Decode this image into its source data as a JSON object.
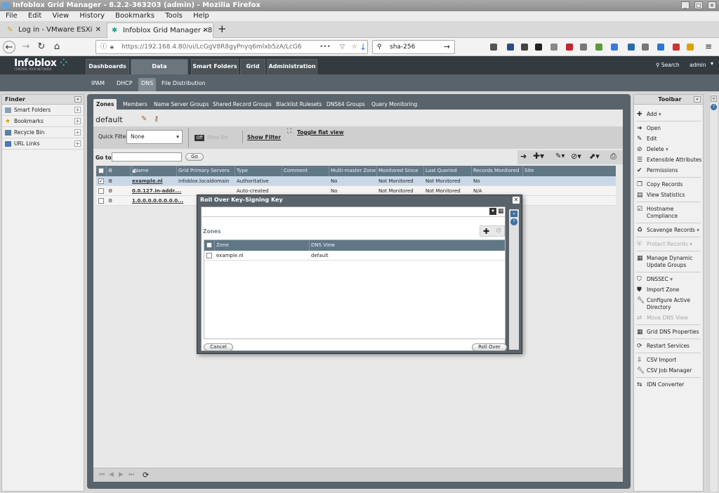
{
  "window": {
    "title": "Infoblox Grid Manager - 8.2.2-363203 (admin) - Mozilla Firefox"
  },
  "menu": [
    "File",
    "Edit",
    "View",
    "History",
    "Bookmarks",
    "Tools",
    "Help"
  ],
  "tabs": [
    {
      "label": "Log in - VMware ESXi"
    },
    {
      "label": "Infoblox Grid Manager - 8"
    }
  ],
  "nav": {
    "url": "https://192.168.4.80/ui/LcGgV8R8gyPnyq6mlxb5zA/LcG6",
    "search": "sha-256"
  },
  "app": {
    "logo": "Infoblox",
    "tagline": "CONTROL YOUR NETWORK",
    "top_tabs": [
      "Dashboards",
      "Data Management",
      "Smart Folders",
      "Grid",
      "Administration"
    ],
    "sub_tabs": [
      "IPAM",
      "DHCP",
      "DNS",
      "File Distribution"
    ],
    "search": "Search",
    "user": "admin"
  },
  "finder": {
    "title": "Finder",
    "items": [
      "Smart Folders",
      "Bookmarks",
      "Recycle Bin",
      "URL Links"
    ]
  },
  "zones_view": {
    "tabs": [
      "Zones",
      "Members",
      "Name Server Groups",
      "Shared Record Groups",
      "Blacklist Rulesets",
      "DNS64 Groups",
      "Query Monitoring"
    ],
    "view": "default",
    "quick_filter_label": "Quick Filter",
    "quick_filter_value": "None",
    "off": "Off",
    "filter_on": "Filter On",
    "show_filter": "Show Filter",
    "toggle_flat": "Toggle flat view",
    "goto_label": "Go to",
    "go_btn": "Go",
    "columns": [
      "Name",
      "Grid Primary Servers",
      "Type",
      "Comment",
      "Multi-master Zone",
      "Monitored Since",
      "Last Queried",
      "Records Monitored",
      "Site"
    ],
    "rows": [
      {
        "name": "example.nl",
        "server": "infoblox.localdomain",
        "type": "Authoritative",
        "comment": "",
        "mm": "No",
        "since": "Not Monitored",
        "queried": "Not Monitored",
        "records": "No"
      },
      {
        "name": "0.0.127.in-addr....",
        "server": "",
        "type": "Auto-created",
        "comment": "",
        "mm": "No",
        "since": "Not Monitored",
        "queried": "Not Monitored",
        "records": "N/A"
      },
      {
        "name": "1.0.0.0.0.0.0.0.0...",
        "server": "",
        "type": "",
        "comment": "",
        "mm": "",
        "since": "",
        "queried": "",
        "records": ""
      }
    ]
  },
  "toolbar": {
    "title": "Toolbar",
    "items": [
      "Add",
      "Open",
      "Edit",
      "Delete",
      "Extensible Attributes",
      "Permissions",
      "Copy Records",
      "View Statistics",
      "Hostname Compliance",
      "Scavenge Records",
      "Protect Records",
      "Manage Dynamic Update Groups",
      "DNSSEC",
      "Import Zone",
      "Configure Active Directory",
      "Move DNS View",
      "Grid DNS Properties",
      "Restart Services",
      "CSV Import",
      "CSV Job Manager",
      "IDN Converter"
    ]
  },
  "modal": {
    "title": "Roll Over Key-Signing Key",
    "section": "Zones",
    "columns": [
      "Zone",
      "DNS View"
    ],
    "rows": [
      {
        "zone": "example.nl",
        "view": "default"
      }
    ],
    "cancel": "Cancel",
    "rollover": "Roll Over"
  }
}
